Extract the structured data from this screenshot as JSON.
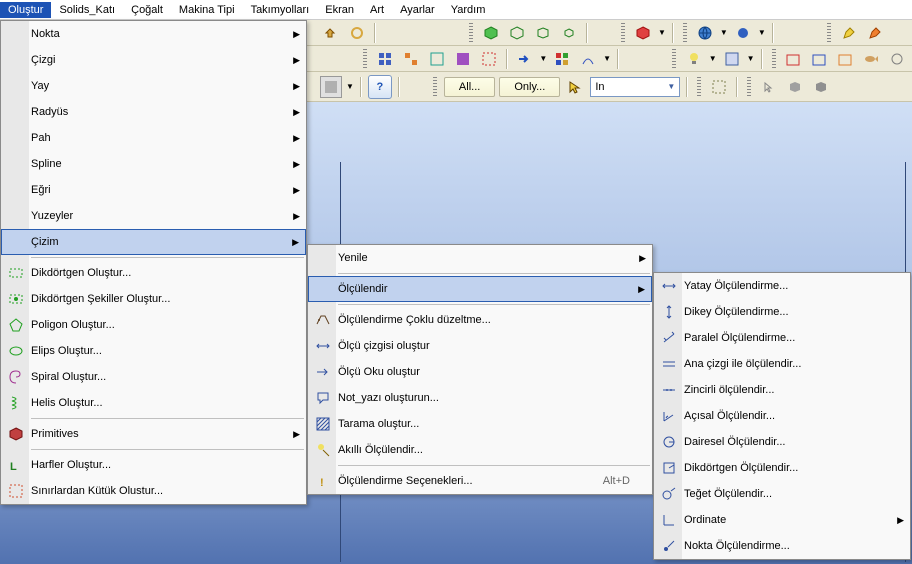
{
  "menubar": [
    "Oluştur",
    "Solids_Katı",
    "Çoğalt",
    "Makina Tipi",
    "Takımyolları",
    "Ekran",
    "Art",
    "Ayarlar",
    "Yardım"
  ],
  "toolbar1_icons": [
    "hand-icon",
    "pan-icon",
    "sep",
    "color-icon",
    "color2-icon",
    "sep",
    "cube-green-icon",
    "cube-wire-icon",
    "cube-small-icon",
    "cube-tiny-icon",
    "sep",
    "box-red-icon",
    "chev",
    "sep",
    "globe-icon",
    "chev",
    "droplet-icon",
    "chev",
    "sep",
    "pencil-yellow-icon",
    "pencil-orange-icon"
  ],
  "toolbar2_icons": [
    "grid-blue-icon",
    "grid-orange-icon",
    "grid-teal-icon",
    "grid-purple-icon",
    "select-red-icon",
    "arrow-blue-icon",
    "chev",
    "grid-4-icon",
    "path-icon",
    "chev",
    "sep",
    "lamp-icon",
    "chev",
    "panel-icon",
    "chev",
    "sep",
    "tab-red-icon",
    "tab-blue-icon",
    "tab-orange-icon",
    "fish-icon",
    "circ-icon"
  ],
  "filter": {
    "all": "All...",
    "only": "Only...",
    "in": "In"
  },
  "dd1_top": [
    "Nokta",
    "Çizgi",
    "Yay",
    "Radyüs",
    "Pah",
    "Spline",
    "Eğri",
    "Yuzeyler",
    "Çizim"
  ],
  "dd1_mid": [
    {
      "label": "Dikdörtgen Oluştur...",
      "icon": "rect-green-icon"
    },
    {
      "label": "Dikdörtgen Şekiller Oluştur...",
      "icon": "rect-shapes-icon"
    },
    {
      "label": "Poligon Oluştur...",
      "icon": "pentagon-icon"
    },
    {
      "label": "Elips Oluştur...",
      "icon": "ellipse-icon"
    },
    {
      "label": "Spiral Oluştur...",
      "icon": "spiral-icon"
    },
    {
      "label": "Helis Oluştur...",
      "icon": "helix-icon"
    }
  ],
  "dd1_bot1": [
    {
      "label": "Primitives",
      "icon": "primitives-icon"
    }
  ],
  "dd1_bot2": [
    {
      "label": "Harfler Oluştur...",
      "icon": "letter-icon"
    },
    {
      "label": "Sınırlardan Kütük Olustur...",
      "icon": "bbox-icon"
    }
  ],
  "dd2_top": [
    {
      "label": "Yenile",
      "arr": true
    }
  ],
  "dd2_top2": [
    {
      "label": "Ölçülendir",
      "arr": true,
      "hover": true
    }
  ],
  "dd2_mid": [
    {
      "label": "Ölçülendirme Çoklu düzeltme...",
      "icon": "multi-edit-icon"
    },
    {
      "label": "Ölçü çizgisi oluştur",
      "icon": "dimline-icon"
    },
    {
      "label": "Ölçü Oku oluştur",
      "icon": "dimarrow-icon"
    },
    {
      "label": "Not_yazı oluşturun...",
      "icon": "note-icon"
    },
    {
      "label": "Tarama oluştur...",
      "icon": "hatch-icon"
    },
    {
      "label": "Akıllı Ölçülendir...",
      "icon": "smart-dim-icon"
    }
  ],
  "dd2_bot": [
    {
      "label": "Ölçülendirme Seçenekleri...",
      "icon": "options-icon",
      "sc": "Alt+D"
    }
  ],
  "dd3": [
    {
      "label": "Yatay Ölçülendirme...",
      "icon": "h-dim-icon"
    },
    {
      "label": "Dikey Ölçülendirme...",
      "icon": "v-dim-icon"
    },
    {
      "label": "Paralel Ölçülendirme...",
      "icon": "par-dim-icon"
    },
    {
      "label": "Ana çizgi ile ölçülendir...",
      "icon": "base-dim-icon"
    },
    {
      "label": "Zincirli ölçülendir...",
      "icon": "chain-dim-icon"
    },
    {
      "label": "Açısal Ölçülendir...",
      "icon": "ang-dim-icon"
    },
    {
      "label": "Dairesel Ölçülendir...",
      "icon": "circ-dim-icon"
    },
    {
      "label": "Dikdörtgen Ölçülendir...",
      "icon": "rect-dim-icon"
    },
    {
      "label": "Teğet Ölçülendir...",
      "icon": "tan-dim-icon"
    },
    {
      "label": "Ordinate",
      "icon": "ord-dim-icon",
      "arr": true
    },
    {
      "label": "Nokta Ölçülendirme...",
      "icon": "pt-dim-icon"
    }
  ]
}
